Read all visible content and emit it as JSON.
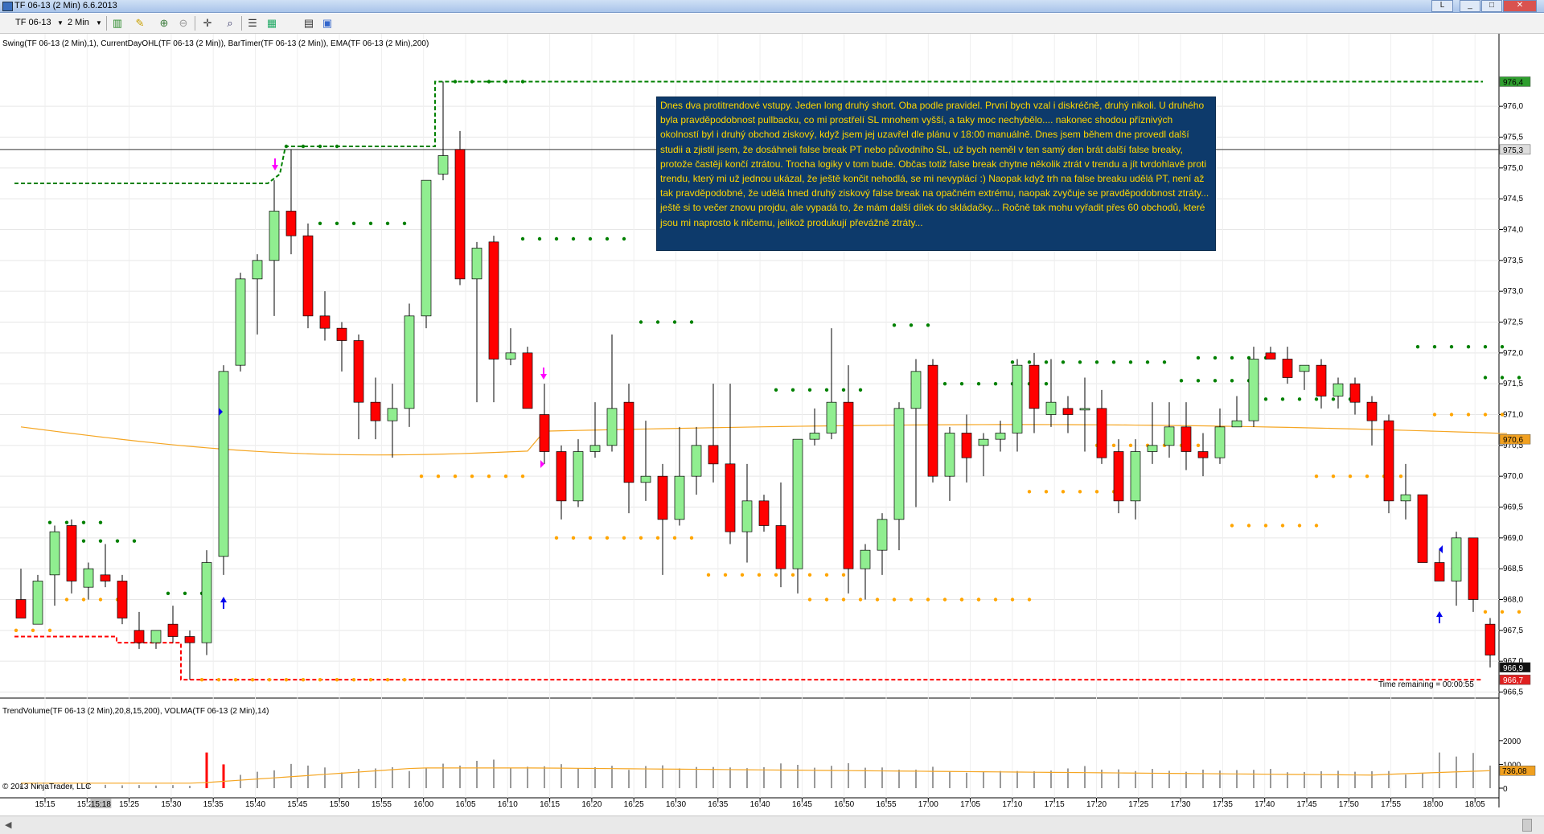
{
  "window": {
    "title": "TF 06-13 (2 Min)  6.6.2013",
    "buttons": [
      "L",
      "_",
      "□",
      "✕"
    ]
  },
  "toolbar": {
    "instrument": "TF 06-13",
    "interval": "2 Min",
    "icons": [
      "bar-type-icon",
      "pencil-icon",
      "zoom-in-icon",
      "zoom-out-icon",
      "crosshair-icon",
      "magnify-icon",
      "properties-icon",
      "template-icon",
      "data-box-icon",
      "grid-icon"
    ]
  },
  "indicators": {
    "top": "Swing(TF 06-13 (2 Min),1), CurrentDayOHL(TF 06-13 (2 Min)), BarTimer(TF 06-13 (2 Min)), EMA(TF 06-13 (2 Min),200)",
    "bottom": "TrendVolume(TF 06-13 (2 Min),20,8,15,200), VOLMA(TF 06-13 (2 Min),14)"
  },
  "copyright": "© 2013 NinjaTrader, LLC",
  "time_remaining": "Time remaining = 00:00:55",
  "note": {
    "text": "Dnes dva protitrendové vstupy. Jeden long druhý short. Oba podle pravidel. První bych vzal i diskréčně, druhý nikoli. U druhého byla pravděpodobnost pullbacku, co mi prostřelí SL mnohem vyšší, a taky moc nechybělo.... nakonec shodou příznivých okolností byl i druhý obchod ziskový, když jsem jej uzavřel dle plánu v 18:00 manuálně. Dnes jsem během dne provedl další studii a zjistil jsem, že dosáhneli false break PT nebo původního SL, už bych neměl v ten samý den brát další false breaky, protože častěji končí ztrátou. Trocha logiky v tom bude. Občas totiž false break chytne několik ztrát v trendu a jít tvrdohlavě proti trendu, který mi už jednou ukázal, že ještě končit nehodlá, se mi nevyplácí :) Naopak když trh na false breaku udělá PT, není až tak pravděpodobné, že udělá hned druhý ziskový false break na opačném extrému, naopak zvyčuje se pravděpodobnost ztráty... ještě si to večer znovu projdu, ale vypadá to, že mám další dílek do skládačky... Ročně tak mohu vyřadit přes 60 obchodů, které jsou mi naprosto k ničemu, jelikož produkují převážně ztráty..."
  },
  "price_axis": {
    "ticks": [
      "976,0",
      "975,5",
      "975,0",
      "974,5",
      "974,0",
      "973,5",
      "973,0",
      "972,5",
      "972,0",
      "971,5",
      "971,0",
      "970,5",
      "970,0",
      "969,5",
      "969,0",
      "968,5",
      "968,0",
      "967,5",
      "967,0",
      "966,5"
    ],
    "tick_values": [
      976.0,
      975.5,
      975.0,
      974.5,
      974.0,
      973.5,
      973.0,
      972.5,
      972.0,
      971.5,
      971.0,
      970.5,
      970.0,
      969.5,
      969.0,
      968.5,
      968.0,
      967.5,
      967.0,
      966.5
    ],
    "markers": [
      {
        "label": "976,4",
        "value": 976.4,
        "color": "#2e9e2e"
      },
      {
        "label": "975,3",
        "value": 975.3,
        "color": "#dddddd"
      },
      {
        "label": "970,6",
        "value": 970.6,
        "color": "#f0a020"
      },
      {
        "label": "966,9",
        "value": 966.9,
        "color": "#111111"
      },
      {
        "label": "966,7",
        "value": 966.7,
        "color": "#e02020"
      }
    ],
    "ylim": [
      966.35,
      976.55
    ]
  },
  "volume_axis": {
    "ticks": [
      "2000",
      "1000",
      "0"
    ],
    "tick_values": [
      2000,
      1000,
      0
    ],
    "marker": {
      "label": "736,08",
      "value": 736.08,
      "color": "#f0a020"
    },
    "ylim": [
      0,
      2300
    ]
  },
  "time_axis": {
    "ticks": [
      "15:15",
      "15:20",
      "15:25",
      "15:30",
      "15:35",
      "15:40",
      "15:45",
      "15:50",
      "15:55",
      "16:00",
      "16:05",
      "16:10",
      "16:15",
      "16:20",
      "16:25",
      "16:30",
      "16:35",
      "16:40",
      "16:45",
      "16:50",
      "16:55",
      "17:00",
      "17:05",
      "17:10",
      "17:15",
      "17:20",
      "17:25",
      "17:30",
      "17:35",
      "17:40",
      "17:45",
      "17:50",
      "17:55",
      "18:00",
      "18:05"
    ],
    "highlighted": "15:18"
  },
  "colors": {
    "up": "#90ee90",
    "down": "#ff0000",
    "swing_high": "#008000",
    "swing_low": "#ffa500",
    "ema": "#f5a623",
    "ohl_high": "#008000",
    "ohl_low": "#ff0000"
  },
  "chart_data": {
    "type": "candlestick",
    "candles": [
      {
        "o": 968.0,
        "h": 968.5,
        "l": 967.7,
        "c": 967.7
      },
      {
        "o": 967.6,
        "h": 968.4,
        "l": 967.6,
        "c": 968.3
      },
      {
        "o": 968.4,
        "h": 969.2,
        "l": 967.9,
        "c": 969.1
      },
      {
        "o": 969.2,
        "h": 969.3,
        "l": 968.1,
        "c": 968.3
      },
      {
        "o": 968.2,
        "h": 968.6,
        "l": 968.0,
        "c": 968.5
      },
      {
        "o": 968.4,
        "h": 968.9,
        "l": 968.2,
        "c": 968.3
      },
      {
        "o": 968.3,
        "h": 968.4,
        "l": 967.6,
        "c": 967.7
      },
      {
        "o": 967.5,
        "h": 967.8,
        "l": 967.2,
        "c": 967.3
      },
      {
        "o": 967.3,
        "h": 967.5,
        "l": 967.2,
        "c": 967.5
      },
      {
        "o": 967.6,
        "h": 967.9,
        "l": 967.3,
        "c": 967.4
      },
      {
        "o": 967.4,
        "h": 967.5,
        "l": 966.7,
        "c": 967.3
      },
      {
        "o": 967.3,
        "h": 968.8,
        "l": 967.1,
        "c": 968.6
      },
      {
        "o": 968.7,
        "h": 971.8,
        "l": 968.4,
        "c": 971.7
      },
      {
        "o": 971.8,
        "h": 973.3,
        "l": 971.7,
        "c": 973.2
      },
      {
        "o": 973.2,
        "h": 973.6,
        "l": 972.3,
        "c": 973.5
      },
      {
        "o": 973.5,
        "h": 974.8,
        "l": 972.6,
        "c": 974.3
      },
      {
        "o": 974.3,
        "h": 975.3,
        "l": 973.6,
        "c": 973.9
      },
      {
        "o": 973.9,
        "h": 974.1,
        "l": 972.4,
        "c": 972.6
      },
      {
        "o": 972.6,
        "h": 973.0,
        "l": 972.2,
        "c": 972.4
      },
      {
        "o": 972.4,
        "h": 972.5,
        "l": 971.7,
        "c": 972.2
      },
      {
        "o": 972.2,
        "h": 972.3,
        "l": 970.6,
        "c": 971.2
      },
      {
        "o": 971.2,
        "h": 971.6,
        "l": 970.6,
        "c": 970.9
      },
      {
        "o": 970.9,
        "h": 971.5,
        "l": 970.3,
        "c": 971.1
      },
      {
        "o": 971.1,
        "h": 972.8,
        "l": 970.8,
        "c": 972.6
      },
      {
        "o": 972.6,
        "h": 974.7,
        "l": 972.4,
        "c": 974.8
      },
      {
        "o": 974.9,
        "h": 976.4,
        "l": 974.8,
        "c": 975.2
      },
      {
        "o": 975.3,
        "h": 975.6,
        "l": 973.1,
        "c": 973.2
      },
      {
        "o": 973.2,
        "h": 973.8,
        "l": 971.2,
        "c": 973.7
      },
      {
        "o": 973.8,
        "h": 973.9,
        "l": 971.2,
        "c": 971.9
      },
      {
        "o": 971.9,
        "h": 972.4,
        "l": 971.8,
        "c": 972.0
      },
      {
        "o": 972.0,
        "h": 972.1,
        "l": 971.1,
        "c": 971.1
      },
      {
        "o": 971.0,
        "h": 971.5,
        "l": 970.2,
        "c": 970.4
      },
      {
        "o": 970.4,
        "h": 970.5,
        "l": 969.3,
        "c": 969.6
      },
      {
        "o": 969.6,
        "h": 970.6,
        "l": 969.5,
        "c": 970.4
      },
      {
        "o": 970.4,
        "h": 971.2,
        "l": 970.3,
        "c": 970.5
      },
      {
        "o": 970.5,
        "h": 972.3,
        "l": 970.4,
        "c": 971.1
      },
      {
        "o": 971.2,
        "h": 971.5,
        "l": 969.4,
        "c": 969.9
      },
      {
        "o": 969.9,
        "h": 970.9,
        "l": 969.6,
        "c": 970.0
      },
      {
        "o": 970.0,
        "h": 970.2,
        "l": 968.4,
        "c": 969.3
      },
      {
        "o": 969.3,
        "h": 970.8,
        "l": 969.2,
        "c": 970.0
      },
      {
        "o": 970.0,
        "h": 970.8,
        "l": 969.7,
        "c": 970.5
      },
      {
        "o": 970.5,
        "h": 971.5,
        "l": 969.9,
        "c": 970.2
      },
      {
        "o": 970.2,
        "h": 971.5,
        "l": 968.9,
        "c": 969.1
      },
      {
        "o": 969.1,
        "h": 970.2,
        "l": 968.6,
        "c": 969.6
      },
      {
        "o": 969.6,
        "h": 969.7,
        "l": 969.1,
        "c": 969.2
      },
      {
        "o": 969.2,
        "h": 969.9,
        "l": 968.2,
        "c": 968.5
      },
      {
        "o": 968.5,
        "h": 970.6,
        "l": 968.1,
        "c": 970.6
      },
      {
        "o": 970.6,
        "h": 971.1,
        "l": 970.5,
        "c": 970.7
      },
      {
        "o": 970.7,
        "h": 972.4,
        "l": 970.6,
        "c": 971.2
      },
      {
        "o": 971.2,
        "h": 971.8,
        "l": 968.1,
        "c": 968.5
      },
      {
        "o": 968.5,
        "h": 968.9,
        "l": 968.0,
        "c": 968.8
      },
      {
        "o": 968.8,
        "h": 969.4,
        "l": 968.4,
        "c": 969.3
      },
      {
        "o": 969.3,
        "h": 971.2,
        "l": 968.8,
        "c": 971.1
      },
      {
        "o": 971.1,
        "h": 971.9,
        "l": 969.5,
        "c": 971.7
      },
      {
        "o": 971.8,
        "h": 971.9,
        "l": 969.9,
        "c": 970.0
      },
      {
        "o": 970.0,
        "h": 970.8,
        "l": 969.6,
        "c": 970.7
      },
      {
        "o": 970.7,
        "h": 971.0,
        "l": 969.9,
        "c": 970.3
      },
      {
        "o": 970.5,
        "h": 970.7,
        "l": 970.0,
        "c": 970.6
      },
      {
        "o": 970.6,
        "h": 970.9,
        "l": 970.4,
        "c": 970.7
      },
      {
        "o": 970.7,
        "h": 971.9,
        "l": 970.4,
        "c": 971.8
      },
      {
        "o": 971.8,
        "h": 972.0,
        "l": 970.7,
        "c": 971.1
      },
      {
        "o": 971.0,
        "h": 971.9,
        "l": 970.8,
        "c": 971.2
      },
      {
        "o": 971.1,
        "h": 971.3,
        "l": 970.7,
        "c": 971.0
      },
      {
        "o": 971.1,
        "h": 971.6,
        "l": 970.4,
        "c": 971.1
      },
      {
        "o": 971.1,
        "h": 971.4,
        "l": 970.2,
        "c": 970.3
      },
      {
        "o": 970.4,
        "h": 970.6,
        "l": 969.4,
        "c": 969.6
      },
      {
        "o": 969.6,
        "h": 970.6,
        "l": 969.3,
        "c": 970.4
      },
      {
        "o": 970.4,
        "h": 971.2,
        "l": 970.2,
        "c": 970.5
      },
      {
        "o": 970.5,
        "h": 971.2,
        "l": 970.3,
        "c": 970.8
      },
      {
        "o": 970.8,
        "h": 971.2,
        "l": 970.1,
        "c": 970.4
      },
      {
        "o": 970.4,
        "h": 970.7,
        "l": 970.0,
        "c": 970.3
      },
      {
        "o": 970.3,
        "h": 971.1,
        "l": 970.2,
        "c": 970.8
      },
      {
        "o": 970.8,
        "h": 971.3,
        "l": 970.8,
        "c": 970.9
      },
      {
        "o": 970.9,
        "h": 972.1,
        "l": 970.8,
        "c": 971.9
      },
      {
        "o": 972.0,
        "h": 972.1,
        "l": 971.9,
        "c": 971.9
      },
      {
        "o": 971.9,
        "h": 972.1,
        "l": 971.5,
        "c": 971.6
      },
      {
        "o": 971.7,
        "h": 971.8,
        "l": 971.4,
        "c": 971.8
      },
      {
        "o": 971.8,
        "h": 971.9,
        "l": 971.1,
        "c": 971.3
      },
      {
        "o": 971.3,
        "h": 971.6,
        "l": 971.1,
        "c": 971.5
      },
      {
        "o": 971.5,
        "h": 971.6,
        "l": 971.0,
        "c": 971.2
      },
      {
        "o": 971.2,
        "h": 971.3,
        "l": 970.5,
        "c": 970.9
      },
      {
        "o": 970.9,
        "h": 971.0,
        "l": 969.4,
        "c": 969.6
      },
      {
        "o": 969.6,
        "h": 970.2,
        "l": 969.3,
        "c": 969.7
      },
      {
        "o": 969.7,
        "h": 969.7,
        "l": 968.7,
        "c": 968.6
      },
      {
        "o": 968.6,
        "h": 968.8,
        "l": 968.4,
        "c": 968.3
      },
      {
        "o": 968.3,
        "h": 969.1,
        "l": 967.9,
        "c": 969.0
      },
      {
        "o": 969.0,
        "h": 969.0,
        "l": 967.8,
        "c": 968.0
      },
      {
        "o": 967.6,
        "h": 967.7,
        "l": 966.9,
        "c": 967.1
      }
    ],
    "ema_start": 970.8,
    "ema_end": 970.6,
    "ohl": {
      "high": 976.4,
      "low": 966.7,
      "open": 967.4
    },
    "volumes": [
      110,
      120,
      130,
      120,
      150,
      140,
      120,
      130,
      110,
      130,
      100,
      1500,
      1000,
      560,
      690,
      750,
      1020,
      950,
      870,
      660,
      810,
      830,
      880,
      720,
      840,
      1030,
      950,
      1150,
      1200,
      830,
      900,
      920,
      1010,
      840,
      880,
      940,
      770,
      930,
      960,
      830,
      890,
      890,
      870,
      840,
      880,
      1040,
      980,
      860,
      940,
      1050,
      860,
      870,
      780,
      780,
      900,
      710,
      650,
      690,
      720,
      720,
      710,
      740,
      830,
      930,
      780,
      790,
      720,
      810,
      730,
      690,
      780,
      740,
      760,
      770,
      810,
      670,
      680,
      710,
      730,
      690,
      710,
      720,
      570,
      640,
      1500,
      1330,
      1480,
      950
    ],
    "volume_signal_bars": [
      11,
      12
    ],
    "volma_start": 210,
    "volma_end": 736.08
  }
}
